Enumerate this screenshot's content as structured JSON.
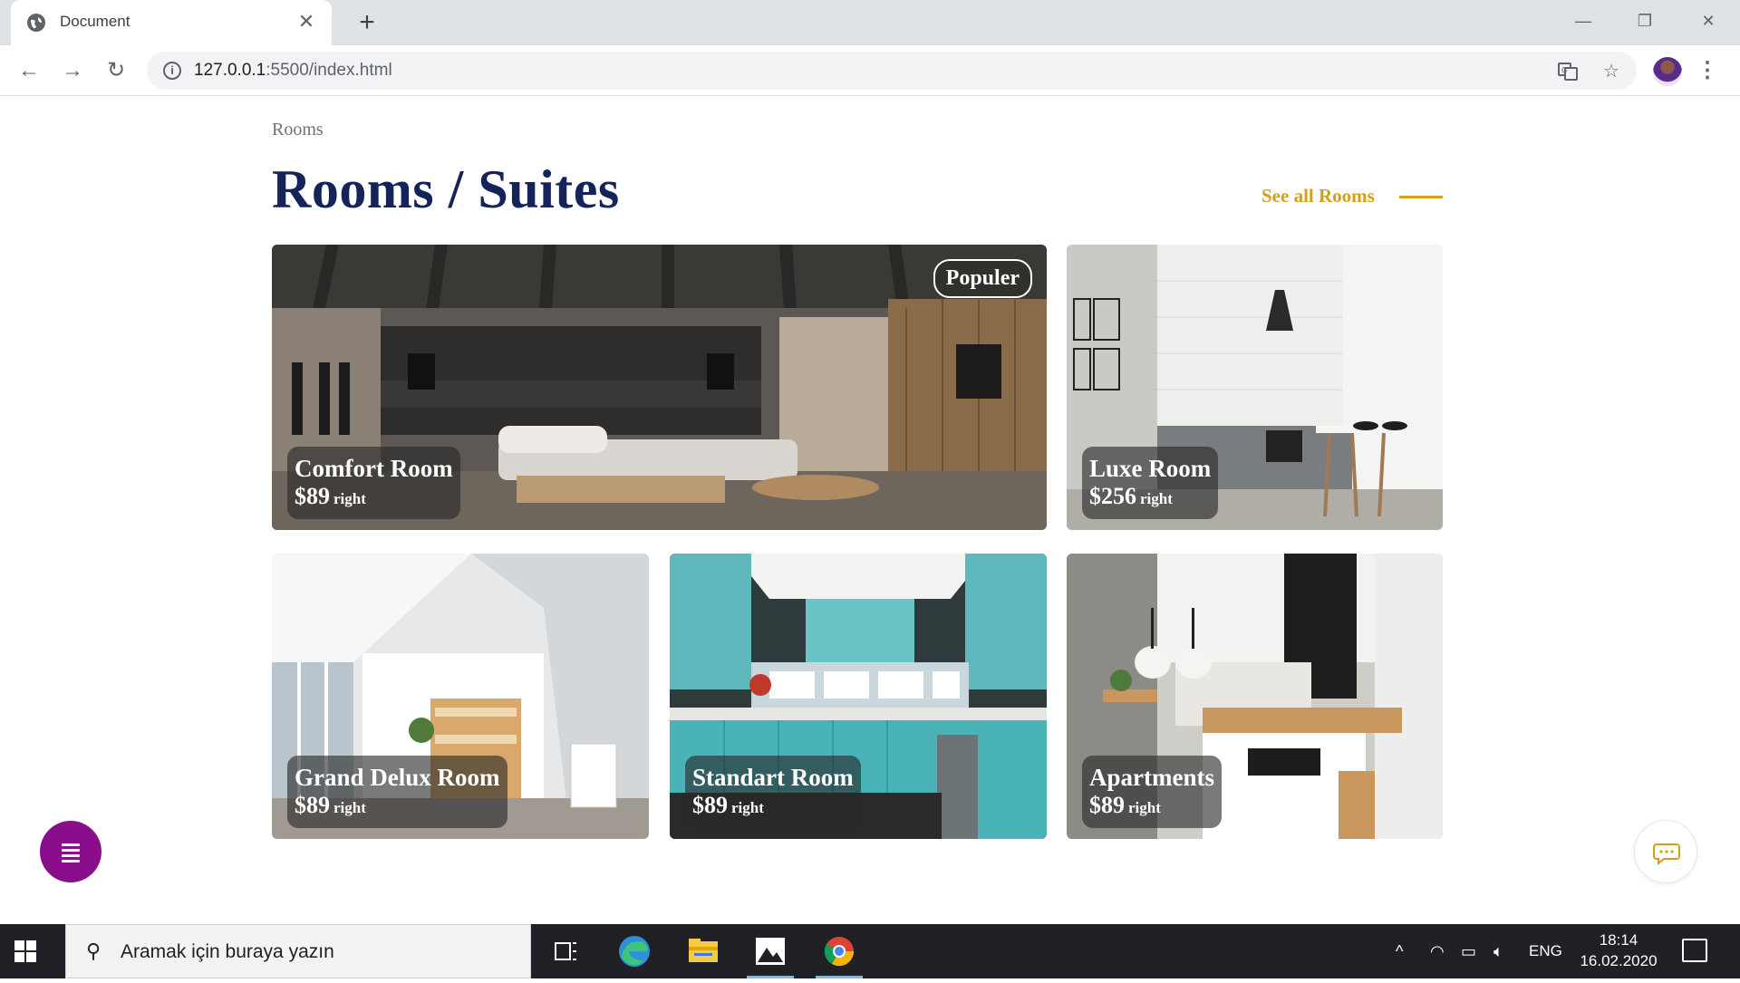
{
  "browser": {
    "tab_title": "Document",
    "url_host": "127.0.0.1",
    "url_rest": ":5500/index.html"
  },
  "page": {
    "breadcrumb": "Rooms",
    "title": "Rooms / Suites",
    "see_all": "See all Rooms"
  },
  "rooms": [
    {
      "name": "Comfort Room",
      "price": "$89",
      "unit": "right",
      "badge": "Populer"
    },
    {
      "name": "Luxe Room",
      "price": "$256",
      "unit": "right"
    },
    {
      "name": "Grand Delux Room",
      "price": "$89",
      "unit": "right"
    },
    {
      "name": "Standart Room",
      "price": "$89",
      "unit": "right"
    },
    {
      "name": "Apartments",
      "price": "$89",
      "unit": "right"
    }
  ],
  "taskbar": {
    "search_placeholder": "Aramak için buraya yazın",
    "language": "ENG",
    "time": "18:14",
    "date": "16.02.2020"
  },
  "colors": {
    "title": "#14245a",
    "accent": "#d4a017",
    "fab": "#8a0e8c"
  }
}
